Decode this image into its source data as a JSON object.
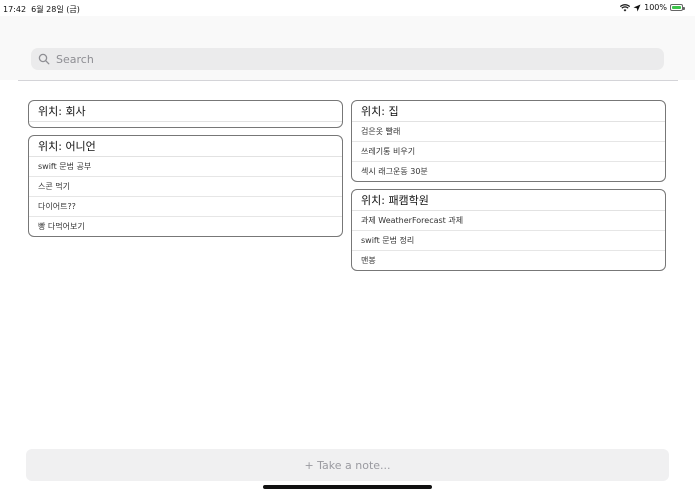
{
  "status_bar": {
    "time": "17:42",
    "date": "6월 28일 (금)",
    "battery_percent": "100%",
    "battery_level": 1.0,
    "icons": [
      "wifi-icon",
      "location-arrow-icon",
      "battery-icon"
    ]
  },
  "search": {
    "placeholder": "Search",
    "value": ""
  },
  "columns": {
    "left": [
      {
        "title": "위치: 회사",
        "items": []
      },
      {
        "title": "위치: 어니언",
        "items": [
          "swift 문법 공부",
          "스콘 먹기",
          "다이어트??",
          "빵 다먹어보기"
        ]
      }
    ],
    "right": [
      {
        "title": "위치: 집",
        "items": [
          "검은옷 빨래",
          "쓰레기통 비우기",
          "섹시 래그운동 30분"
        ]
      },
      {
        "title": "위치: 패캠학원",
        "items": [
          "과제 WeatherForecast 과제",
          "swift 문법 정리",
          "맨봉"
        ]
      }
    ]
  },
  "note_bar": {
    "placeholder": "+ Take a note..."
  },
  "colors": {
    "battery_green": "#3cc44a",
    "search_bg": "#ebebec",
    "card_border": "#777777"
  }
}
